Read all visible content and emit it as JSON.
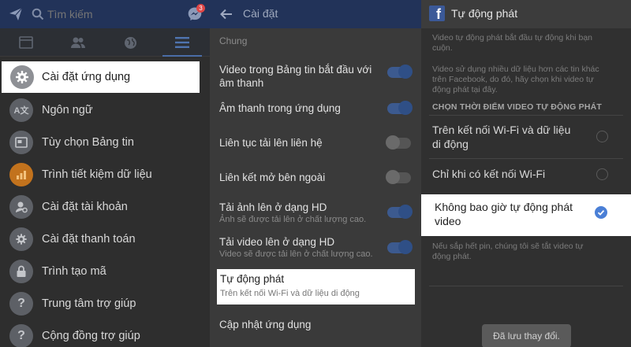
{
  "panel1": {
    "search_placeholder": "Tìm kiếm",
    "messenger_badge": "3",
    "menu": [
      {
        "label": "Cài đặt ứng dụng"
      },
      {
        "label": "Ngôn ngữ"
      },
      {
        "label": "Tùy chọn Bảng tin"
      },
      {
        "label": "Trình tiết kiệm dữ liệu"
      },
      {
        "label": "Cài đặt tài khoản"
      },
      {
        "label": "Cài đặt thanh toán"
      },
      {
        "label": "Trình tạo mã"
      },
      {
        "label": "Trung tâm trợ giúp"
      },
      {
        "label": "Cộng đồng trợ giúp"
      }
    ]
  },
  "panel2": {
    "title": "Cài đặt",
    "section": "Chung",
    "settings": [
      {
        "line1": "Video trong Bảng tin bắt đầu với",
        "line2": "âm thanh",
        "on": true
      },
      {
        "line1": "Âm thanh trong ứng dụng",
        "on": true
      },
      {
        "line1": "Liên tục tải lên liên hệ",
        "on": false
      },
      {
        "line1": "Liên kết mở bên ngoài",
        "on": false
      },
      {
        "line1": "Tải ảnh lên ở dạng HD",
        "sub": "Ảnh sẽ được tải lên ở chất lượng cao.",
        "on": true
      },
      {
        "line1": "Tải video lên ở dạng HD",
        "sub": "Video sẽ được tải lên ở chất lượng cao.",
        "on": true
      }
    ],
    "autoplay": {
      "title": "Tự động phát",
      "sub": "Trên kết nối Wi-Fi và dữ liệu di động"
    },
    "update": "Cập nhật ứng dụng"
  },
  "panel3": {
    "title": "Tự động phát",
    "desc1_line1": "Video tự động phát bắt đầu tự động khi bạn",
    "desc1_line2": "cuộn.",
    "desc2_line1": "Video sử dụng nhiều dữ liệu hơn các tin khác",
    "desc2_line2": "trên Facebook, do đó, hãy chọn khi video tự",
    "desc2_line3": "động phát tại đây.",
    "header": "CHỌN THỜI ĐIỂM VIDEO TỰ ĐỘNG PHÁT",
    "option1_line1": "Trên kết nối Wi-Fi và dữ liệu",
    "option1_line2": "di động",
    "option2": "Chỉ khi có kết nối Wi-Fi",
    "option3_line1": "Không bao giờ tự động phát",
    "option3_line2": "video",
    "note_line1": "Nếu sắp hết pin, chúng tôi sẽ tắt video tự",
    "note_line2": "động phát.",
    "toast": "Đã lưu thay đổi."
  },
  "colors": {
    "top_bar": "#223359",
    "accent": "#3c5a8f",
    "check": "#4a7fd6"
  }
}
